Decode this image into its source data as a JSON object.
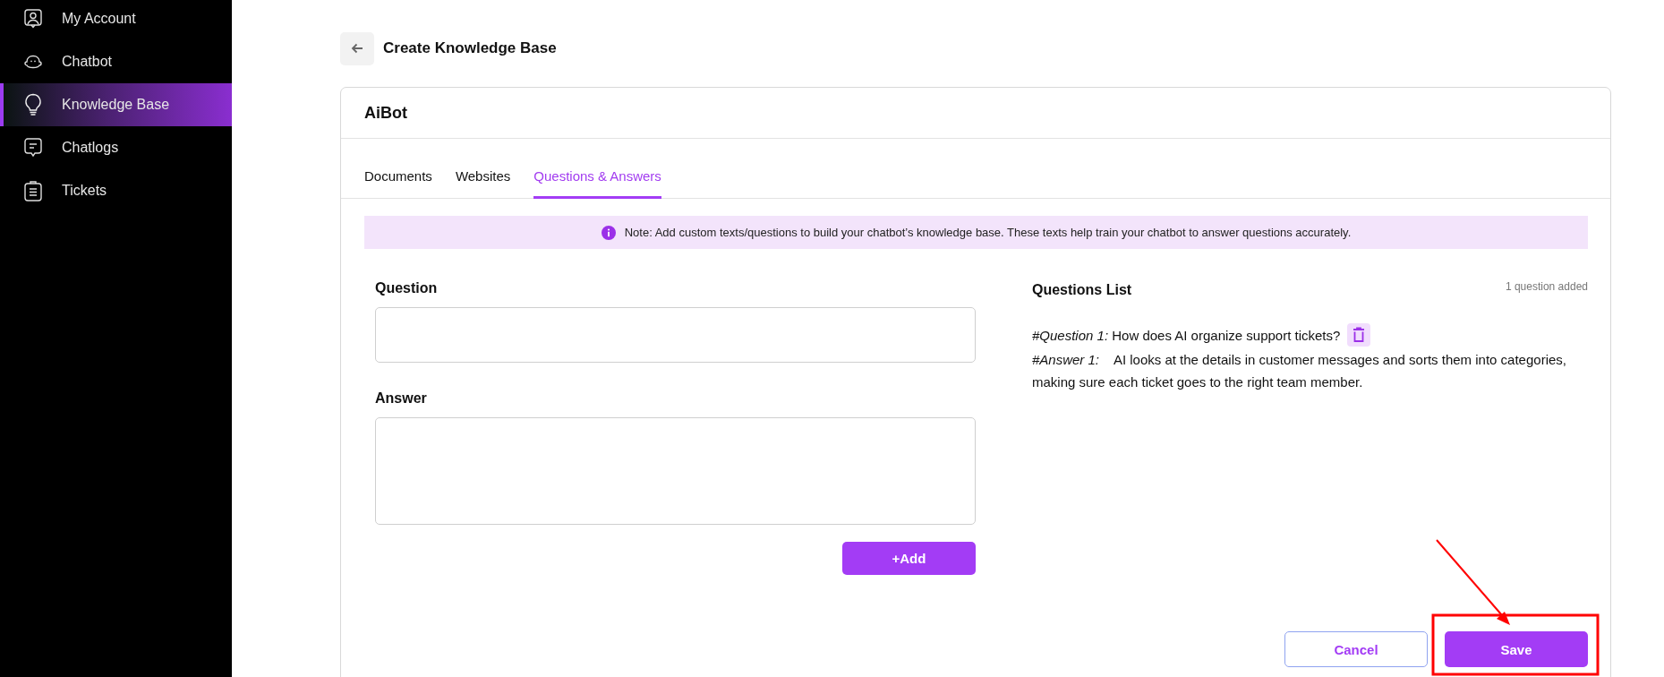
{
  "sidebar": {
    "items": [
      {
        "label": "My Account",
        "selected": false
      },
      {
        "label": "Chatbot",
        "selected": false
      },
      {
        "label": "Knowledge Base",
        "selected": true
      },
      {
        "label": "Chatlogs",
        "selected": false
      },
      {
        "label": "Tickets",
        "selected": false
      }
    ]
  },
  "page": {
    "title": "Create Knowledge Base"
  },
  "card": {
    "title": "AiBot",
    "tabs": [
      {
        "label": "Documents",
        "selected": false
      },
      {
        "label": "Websites",
        "selected": false
      },
      {
        "label": "Questions & Answers",
        "selected": true
      }
    ],
    "note": "Note: Add custom texts/questions to build your chatbot’s knowledge base. These texts help train your chatbot to answer questions accurately.",
    "form": {
      "question_label": "Question",
      "answer_label": "Answer",
      "add_button": "+Add"
    },
    "questions_list": {
      "title": "Questions List",
      "count": "1 question added",
      "items": [
        {
          "question_label": "#Question 1:",
          "question": "How does AI organize support tickets?",
          "answer_label": "#Answer 1:",
          "answer": "AI looks at the details in customer messages and sorts them into categories, making sure each ticket goes to the right team member."
        }
      ]
    },
    "buttons": {
      "cancel": "Cancel",
      "save": "Save"
    }
  }
}
